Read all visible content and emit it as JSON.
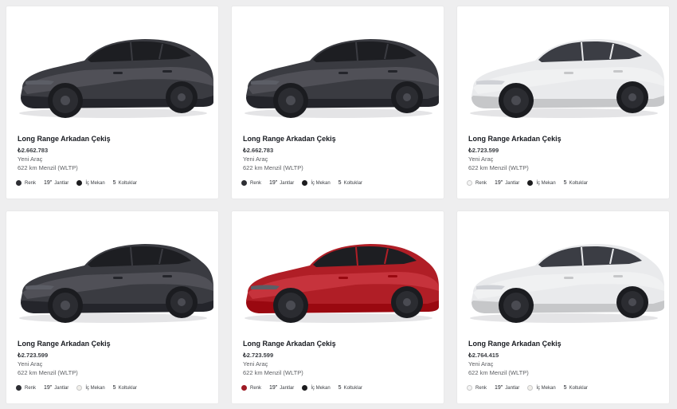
{
  "cards": [
    {
      "title": "Long Range Arkadan Çekiş",
      "price": "₺2.662.783",
      "condition": "Yeni Araç",
      "range": "622 km Menzil (WLTP)",
      "paint_label": "Renk",
      "paint_color": "#2d2e33",
      "wheels_size": "19\"",
      "wheels_label": "Jantlar",
      "interior_label": "İç Mekan",
      "interior_color": "#1c1c1e",
      "seats_count": "5",
      "seats_label": "Koltuklar",
      "car_color": "#3a3b41"
    },
    {
      "title": "Long Range Arkadan Çekiş",
      "price": "₺2.662.783",
      "condition": "Yeni Araç",
      "range": "622 km Menzil (WLTP)",
      "paint_label": "Renk",
      "paint_color": "#2d2e33",
      "wheels_size": "19\"",
      "wheels_label": "Jantlar",
      "interior_label": "İç Mekan",
      "interior_color": "#1c1c1e",
      "seats_count": "5",
      "seats_label": "Koltuklar",
      "car_color": "#3a3b41"
    },
    {
      "title": "Long Range Arkadan Çekiş",
      "price": "₺2.723.599",
      "condition": "Yeni Araç",
      "range": "622 km Menzil (WLTP)",
      "paint_label": "Renk",
      "paint_color": "#f4f4f4",
      "wheels_size": "19\"",
      "wheels_label": "Jantlar",
      "interior_label": "İç Mekan",
      "interior_color": "#1c1c1e",
      "seats_count": "5",
      "seats_label": "Koltuklar",
      "car_color": "#e9eaec"
    },
    {
      "title": "Long Range Arkadan Çekiş",
      "price": "₺2.723.599",
      "condition": "Yeni Araç",
      "range": "622 km Menzil (WLTP)",
      "paint_label": "Renk",
      "paint_color": "#2d2e33",
      "wheels_size": "19\"",
      "wheels_label": "Jantlar",
      "interior_label": "İç Mekan",
      "interior_color": "#f1efea",
      "seats_count": "5",
      "seats_label": "Koltuklar",
      "car_color": "#3a3b41"
    },
    {
      "title": "Long Range Arkadan Çekiş",
      "price": "₺2.723.599",
      "condition": "Yeni Araç",
      "range": "622 km Menzil (WLTP)",
      "paint_label": "Renk",
      "paint_color": "#9e1a24",
      "wheels_size": "19\"",
      "wheels_label": "Jantlar",
      "interior_label": "İç Mekan",
      "interior_color": "#1c1c1e",
      "seats_count": "5",
      "seats_label": "Koltuklar",
      "car_color": "#b01e26"
    },
    {
      "title": "Long Range Arkadan Çekiş",
      "price": "₺2.764.415",
      "condition": "Yeni Araç",
      "range": "622 km Menzil (WLTP)",
      "paint_label": "Renk",
      "paint_color": "#f4f4f4",
      "wheels_size": "19\"",
      "wheels_label": "Jantlar",
      "interior_label": "İç Mekan",
      "interior_color": "#f1efea",
      "seats_count": "5",
      "seats_label": "Koltuklar",
      "car_color": "#e9eaec"
    }
  ]
}
